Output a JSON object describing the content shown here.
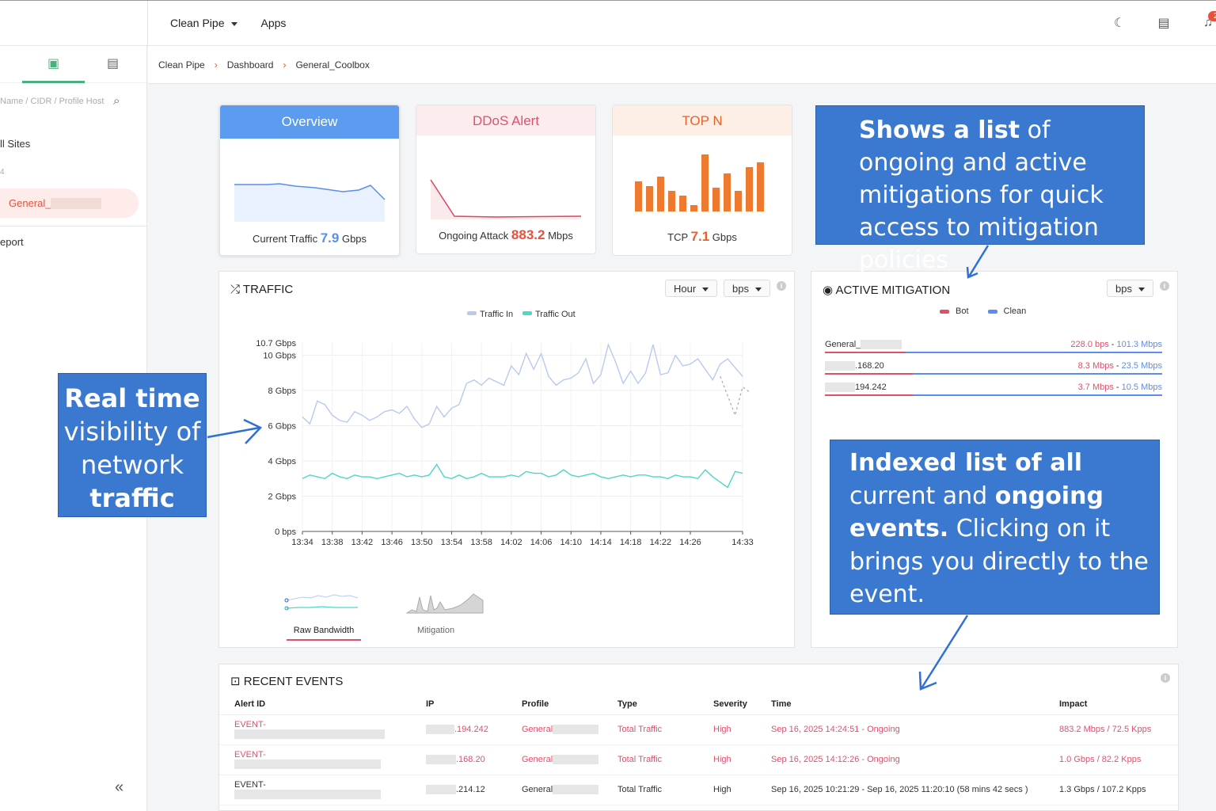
{
  "topbar": {
    "nav": [
      "Clean Pipe",
      "Apps"
    ],
    "notification_count": "2"
  },
  "sidebar": {
    "search_placeholder": "Name / CIDR / Profile Host",
    "items": [
      "ll Sites",
      "4",
      "General_",
      "eport"
    ]
  },
  "breadcrumb": [
    "Clean Pipe",
    "Dashboard",
    "General_Coolbox"
  ],
  "cards": {
    "overview": {
      "title": "Overview",
      "label": "Current Traffic",
      "value": "7.9",
      "unit": "Gbps"
    },
    "ddos": {
      "title": "DDoS Alert",
      "label": "Ongoing Attack",
      "value": "883.2",
      "unit": "Mbps"
    },
    "topn": {
      "title": "TOP N",
      "label": "TCP",
      "value": "7.1",
      "unit": "Gbps"
    }
  },
  "traffic": {
    "title": "TRAFFIC",
    "range": "Hour",
    "unit": "bps",
    "tabs": [
      "Raw Bandwidth",
      "Mitigation"
    ]
  },
  "active_mitigation": {
    "title": "ACTIVE MITIGATION",
    "unit": "bps",
    "legend": [
      "Bot",
      "Clean"
    ],
    "rows": [
      {
        "name": "General_",
        "bot": "228.0 bps",
        "clean": "101.3 Mbps",
        "ratio": 0.24
      },
      {
        "name": ".168.20",
        "bot": "8.3 Mbps",
        "clean": "23.5 Mbps",
        "ratio": 0.26
      },
      {
        "name": "194.242",
        "bot": "3.7 Mbps",
        "clean": "10.5 Mbps",
        "ratio": 0.26
      }
    ]
  },
  "recent_events": {
    "title": "RECENT EVENTS",
    "columns": [
      "Alert ID",
      "IP",
      "Profile",
      "Type",
      "Severity",
      "Time",
      "Impact"
    ],
    "rows": [
      {
        "id": "EVENT-",
        "ip": ".194.242",
        "profile": "General",
        "type": "Total Traffic",
        "severity": "High",
        "time": "Sep 16, 2025 14:24:51 - Ongoing",
        "impact": "883.2 Mbps / 72.5 Kpps",
        "active": true
      },
      {
        "id": "EVENT-",
        "ip": ".168.20",
        "profile": "General",
        "type": "Total Traffic",
        "severity": "High",
        "time": "Sep 16, 2025 14:12:26 - Ongoing",
        "impact": "1.0 Gbps / 82.2 Kpps",
        "active": true
      },
      {
        "id": "EVENT-",
        "ip": ".214.12",
        "profile": "General",
        "type": "Total Traffic",
        "severity": "High",
        "time": "Sep 16, 2025 10:21:29 - Sep 16, 2025 11:20:10 (58 mins 42 secs )",
        "impact": "1.3 Gbps / 107.2 Kpps",
        "active": false
      }
    ]
  },
  "callouts": {
    "top": [
      {
        "text": "Shows a list",
        "bold": true
      },
      {
        "text": " of ongoing and active mitigations for quick access to mitigation policies",
        "bold": false
      }
    ],
    "left": [
      {
        "text": "Real time",
        "bold": true
      },
      {
        "text": " visibility of network ",
        "bold": false
      },
      {
        "text": "traffic",
        "bold": true
      }
    ],
    "right": [
      {
        "text": "Indexed list of all",
        "bold": true
      },
      {
        "text": " current and ",
        "bold": false
      },
      {
        "text": "ongoing events.",
        "bold": true
      },
      {
        "text": " Clicking on it brings you directly to the event.",
        "bold": false
      }
    ]
  },
  "chart_data": {
    "type": "line",
    "title": "",
    "xlabel": "",
    "ylabel": "",
    "y_tick_labels": [
      "0 bps",
      "2 Gbps",
      "4 Gbps",
      "6 Gbps",
      "8 Gbps",
      "10 Gbps",
      "10.7 Gbps"
    ],
    "y_ticks": [
      0,
      2,
      4,
      6,
      8,
      10,
      10.7
    ],
    "ylim": [
      0,
      10.7
    ],
    "x_tick_labels": [
      "13:34",
      "13:38",
      "13:42",
      "13:46",
      "13:50",
      "13:54",
      "13:58",
      "14:02",
      "14:06",
      "14:10",
      "14:14",
      "14:18",
      "14:22",
      "14:26",
      "14:33"
    ],
    "legend": [
      "Traffic In",
      "Traffic Out"
    ],
    "legend_position": "top-center",
    "colors": {
      "in": "#b9c9ef",
      "out": "#4fd6c6"
    },
    "series": [
      {
        "name": "Traffic In",
        "x_minutes": [
          0,
          1,
          2,
          3,
          4,
          5,
          6,
          7,
          8,
          9,
          10,
          11,
          12,
          13,
          14,
          15,
          16,
          17,
          18,
          19,
          20,
          21,
          22,
          23,
          24,
          25,
          26,
          27,
          28,
          29,
          30,
          31,
          32,
          33,
          34,
          35,
          36,
          37,
          38,
          39,
          40,
          41,
          42,
          43,
          44,
          45,
          46,
          47,
          48,
          49,
          50,
          51,
          52,
          53,
          54,
          55,
          56,
          57,
          58,
          59
        ],
        "values": [
          6.5,
          6.1,
          7.4,
          7.2,
          6.6,
          6.3,
          6.2,
          6.8,
          6.6,
          6.3,
          6.5,
          6.8,
          6.9,
          6.7,
          7.1,
          6.4,
          5.9,
          6.1,
          7.1,
          6.5,
          7.0,
          7.2,
          8.4,
          8.6,
          8.3,
          8.7,
          8.5,
          8.3,
          9.4,
          8.9,
          10.1,
          9.2,
          10.1,
          8.8,
          8.3,
          8.6,
          8.7,
          9.0,
          9.8,
          8.4,
          8.9,
          10.6,
          9.6,
          8.4,
          9.1,
          8.4,
          9.0,
          10.6,
          8.9,
          9.0,
          10.0,
          9.4,
          9.5,
          9.8,
          9.2,
          8.6,
          9.5,
          9.8,
          9.3,
          8.8
        ],
        "dashed_from_index": 56,
        "dashed_values": [
          8.8,
          7.7,
          6.6,
          8.2,
          7.9
        ]
      },
      {
        "name": "Traffic Out",
        "x_minutes": [
          0,
          1,
          2,
          3,
          4,
          5,
          6,
          7,
          8,
          9,
          10,
          11,
          12,
          13,
          14,
          15,
          16,
          17,
          18,
          19,
          20,
          21,
          22,
          23,
          24,
          25,
          26,
          27,
          28,
          29,
          30,
          31,
          32,
          33,
          34,
          35,
          36,
          37,
          38,
          39,
          40,
          41,
          42,
          43,
          44,
          45,
          46,
          47,
          48,
          49,
          50,
          51,
          52,
          53,
          54,
          55,
          56,
          57,
          58,
          59
        ],
        "values": [
          3.0,
          3.2,
          3.1,
          3.0,
          3.3,
          3.1,
          3.0,
          3.2,
          3.1,
          3.1,
          3.0,
          3.1,
          3.2,
          3.3,
          3.1,
          3.2,
          3.1,
          3.2,
          3.8,
          3.1,
          3.0,
          3.2,
          3.0,
          3.1,
          3.3,
          3.1,
          3.1,
          3.1,
          3.2,
          3.1,
          3.4,
          3.3,
          3.3,
          3.1,
          3.2,
          3.5,
          3.2,
          3.1,
          3.2,
          3.3,
          3.1,
          3.0,
          3.1,
          3.2,
          3.1,
          3.2,
          3.2,
          3.1,
          3.1,
          3.0,
          3.2,
          3.1,
          3.1,
          3.0,
          3.5,
          3.1,
          2.8,
          2.5,
          3.4,
          3.3
        ]
      }
    ]
  }
}
